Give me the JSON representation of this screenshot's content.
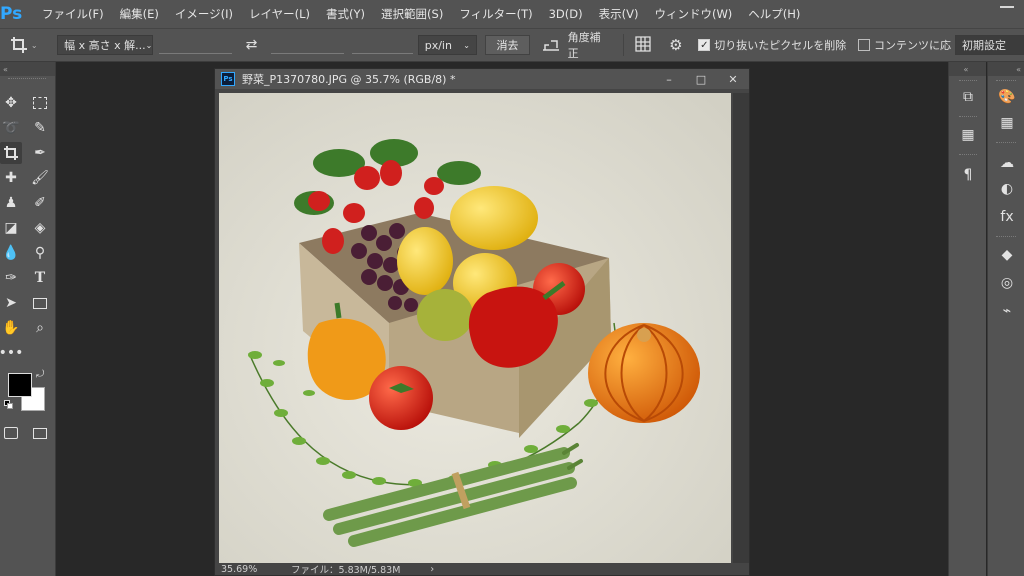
{
  "app": {
    "logo": "Ps"
  },
  "menu": [
    "ファイル(F)",
    "編集(E)",
    "イメージ(I)",
    "レイヤー(L)",
    "書式(Y)",
    "選択範囲(S)",
    "フィルター(T)",
    "3D(D)",
    "表示(V)",
    "ウィンドウ(W)",
    "ヘルプ(H)"
  ],
  "options": {
    "ratio_select": "幅 x 高さ x 解...",
    "unit_select": "px/in",
    "clear_button": "消去",
    "straighten_label": "角度補正",
    "delete_pixels_label": "切り抜いたピクセルを削除",
    "delete_pixels_checked": true,
    "content_aware_label": "コンテンツに応",
    "content_aware_checked": false,
    "reset_label": "初期設定"
  },
  "document": {
    "title": "野菜_P1370780.JPG @ 35.7% (RGB/8) *",
    "zoom": "35.69%",
    "file_info": "ファイル：5.83M/5.83M",
    "controls": [
      "–",
      "□",
      "✕"
    ]
  },
  "colors": {
    "foreground": "#000000",
    "background": "#ffffff",
    "ps_blue": "#31a8ff"
  },
  "tools_left": [
    "move-icon",
    "marquee-icon",
    "lasso-icon",
    "quick-select-icon",
    "crop-icon",
    "eyedropper-icon",
    "healing-icon",
    "brush-icon",
    "stamp-icon",
    "history-brush-icon",
    "eraser-icon",
    "bucket-icon",
    "blur-icon",
    "dodge-icon",
    "pen-icon",
    "type-icon",
    "path-select-icon",
    "shape-icon",
    "hand-icon",
    "zoom-icon",
    "more-icon"
  ],
  "panels_right": [
    "history-icon",
    "properties-icon",
    "paragraph-icon",
    "color-icon",
    "swatches-icon",
    "libraries-icon",
    "adjustments-icon",
    "styles-icon",
    "layers-icon",
    "channels-icon",
    "paths-icon"
  ]
}
